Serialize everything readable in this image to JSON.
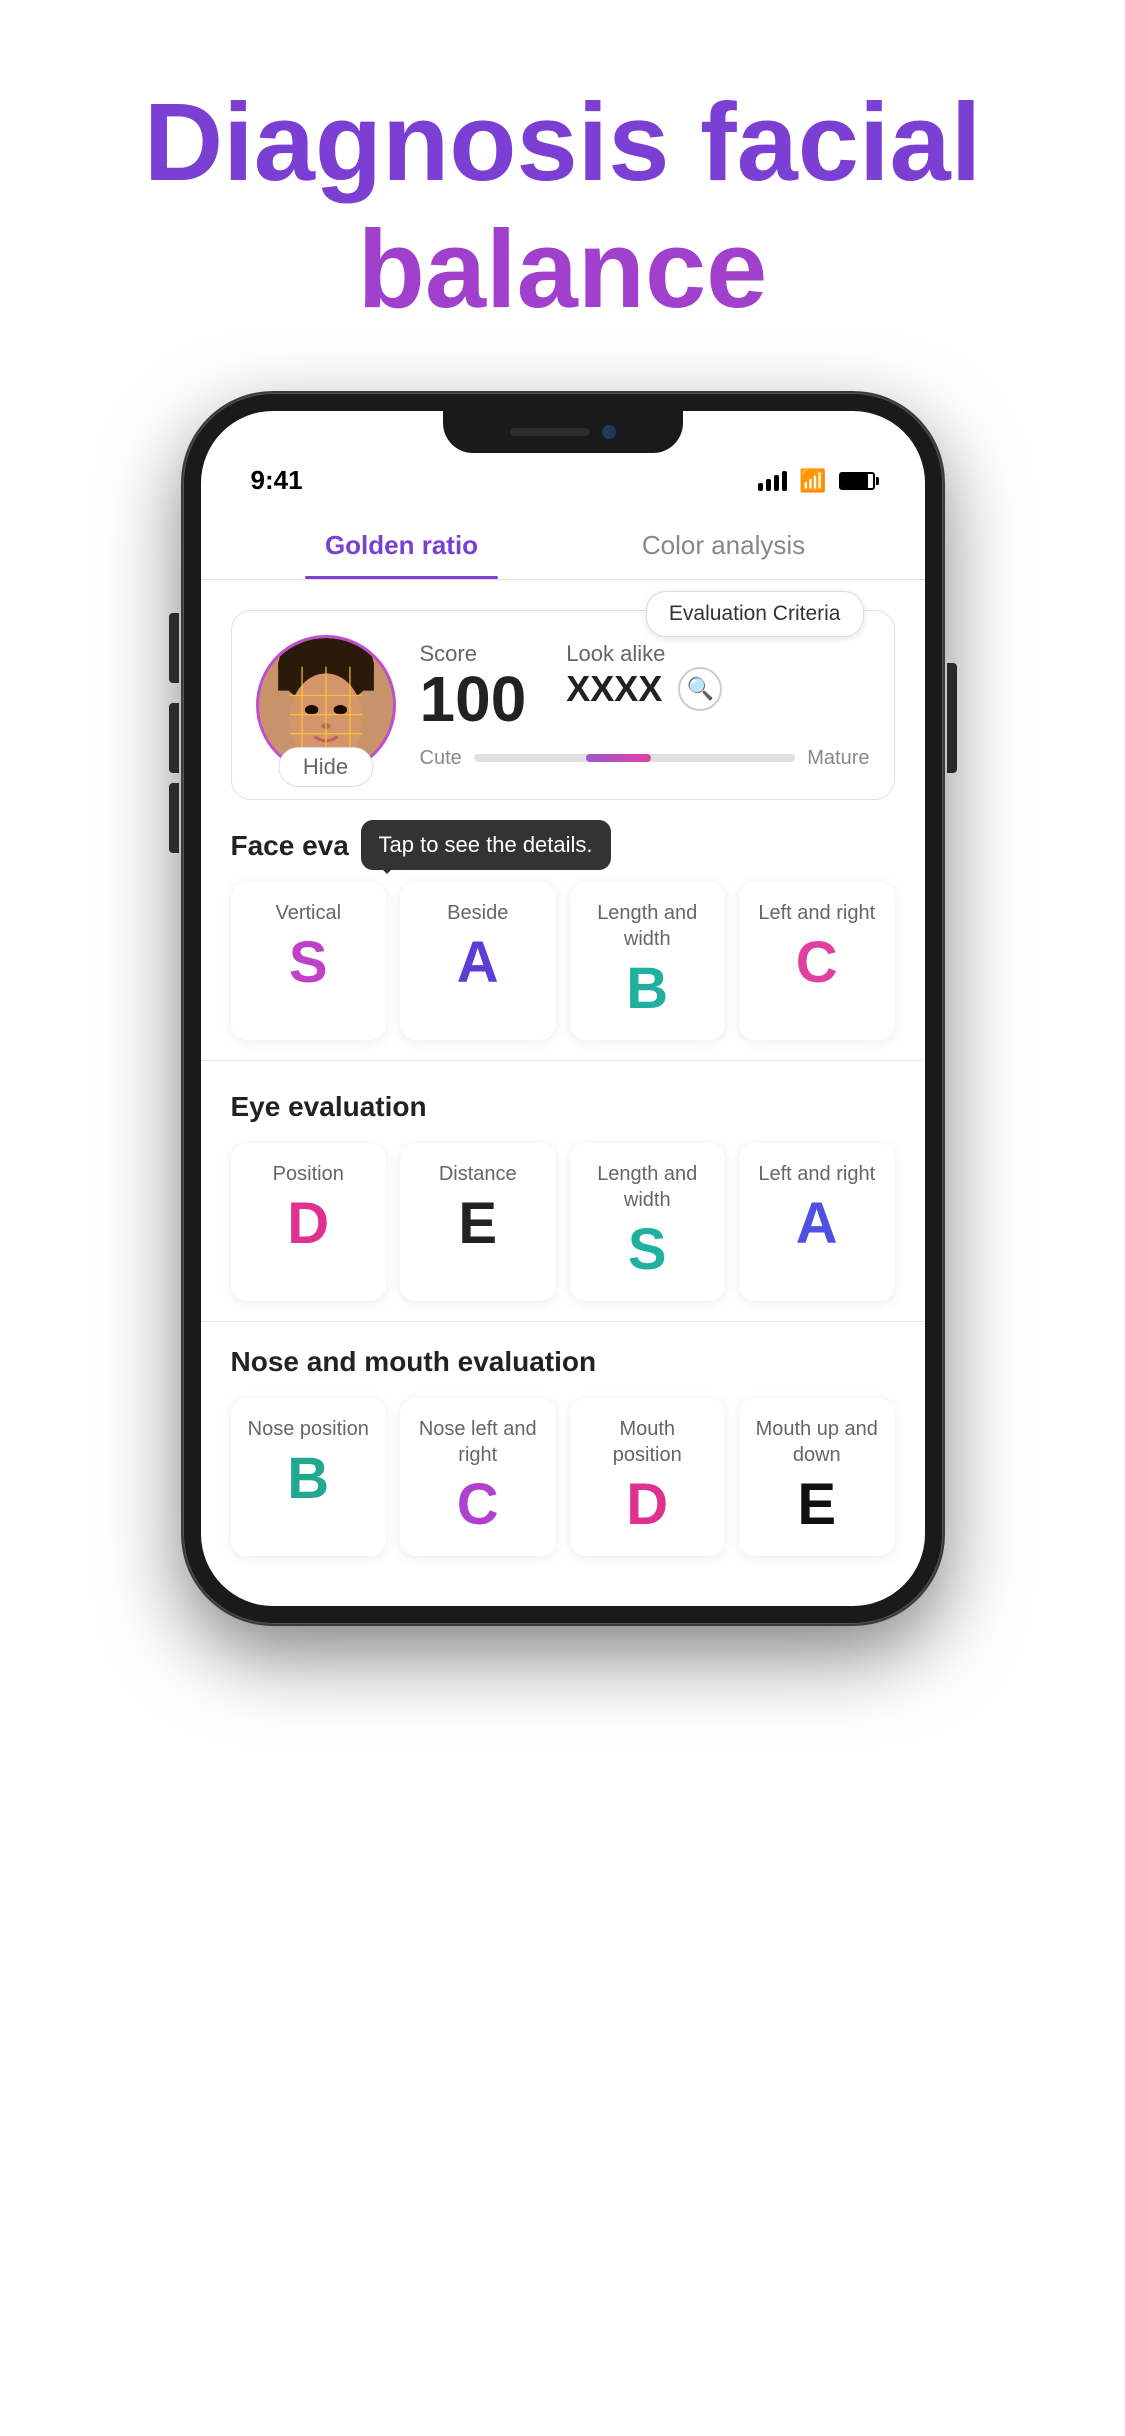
{
  "page": {
    "title_part1": "Diagnosis facial",
    "title_part2": "balance"
  },
  "status_bar": {
    "time": "9:41",
    "signal": "4 bars",
    "wifi": true,
    "battery": "full"
  },
  "tabs": [
    {
      "id": "golden-ratio",
      "label": "Golden ratio",
      "active": true
    },
    {
      "id": "color-analysis",
      "label": "Color analysis",
      "active": false
    }
  ],
  "score_card": {
    "score_label": "Score",
    "score_value": "100",
    "look_alike_label": "Look alike",
    "look_alike_value": "XXXX",
    "hide_button": "Hide",
    "cute_label": "Cute",
    "mature_label": "Mature",
    "eval_criteria_label": "Evaluation\nCriteria"
  },
  "face_evaluation": {
    "section_title": "Face eva",
    "tooltip": "Tap to see\nthe details.",
    "cards": [
      {
        "label": "Vertical",
        "grade": "S",
        "grade_class": "grade-s"
      },
      {
        "label": "Beside",
        "grade": "A",
        "grade_class": "grade-a-purple"
      },
      {
        "label": "Length and\nwidth",
        "grade": "B",
        "grade_class": "grade-b-teal"
      },
      {
        "label": "Left and\nright",
        "grade": "C",
        "grade_class": "grade-c-pink"
      }
    ]
  },
  "eye_evaluation": {
    "section_title": "Eye evaluation",
    "cards": [
      {
        "label": "Position",
        "grade": "D",
        "grade_class": "grade-d-pink"
      },
      {
        "label": "Distance",
        "grade": "E",
        "grade_class": "grade-e-dark"
      },
      {
        "label": "Length and\nwidth",
        "grade": "S",
        "grade_class": "grade-s-teal"
      },
      {
        "label": "Left and\nright",
        "grade": "A",
        "grade_class": "grade-a-blue"
      }
    ]
  },
  "nose_mouth_evaluation": {
    "section_title": "Nose and mouth evaluation",
    "cards": [
      {
        "label": "Nose\nposition",
        "grade": "B",
        "grade_class": "grade-b-teal2"
      },
      {
        "label": "Nose left\nand right",
        "grade": "C",
        "grade_class": "grade-c-purple"
      },
      {
        "label": "Mouth\nposition",
        "grade": "D",
        "grade_class": "grade-d-pink2"
      },
      {
        "label": "Mouth up\nand down",
        "grade": "E",
        "grade_class": "grade-e-black"
      }
    ]
  }
}
